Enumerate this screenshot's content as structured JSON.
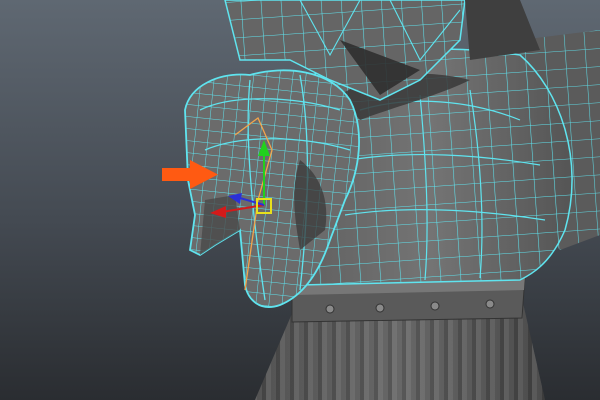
{
  "viewport": {
    "icon": "3d-viewport-icon",
    "background_top": "#5f6872",
    "background_bottom": "#2a2d31",
    "wireframe_color": "#5fe4ef",
    "mesh_shade": "#6b6b6b",
    "mesh_shade_dark": "#3d3d3d",
    "annotation_arrow_color": "#ff5a12",
    "selection_edge_color": "#f2a44c",
    "manipulator": {
      "y_axis_color": "#22d11c",
      "x_axis_color": "#d41a1a",
      "z_axis_color": "#2b30d8",
      "pivot_color": "#e8e01c"
    }
  }
}
